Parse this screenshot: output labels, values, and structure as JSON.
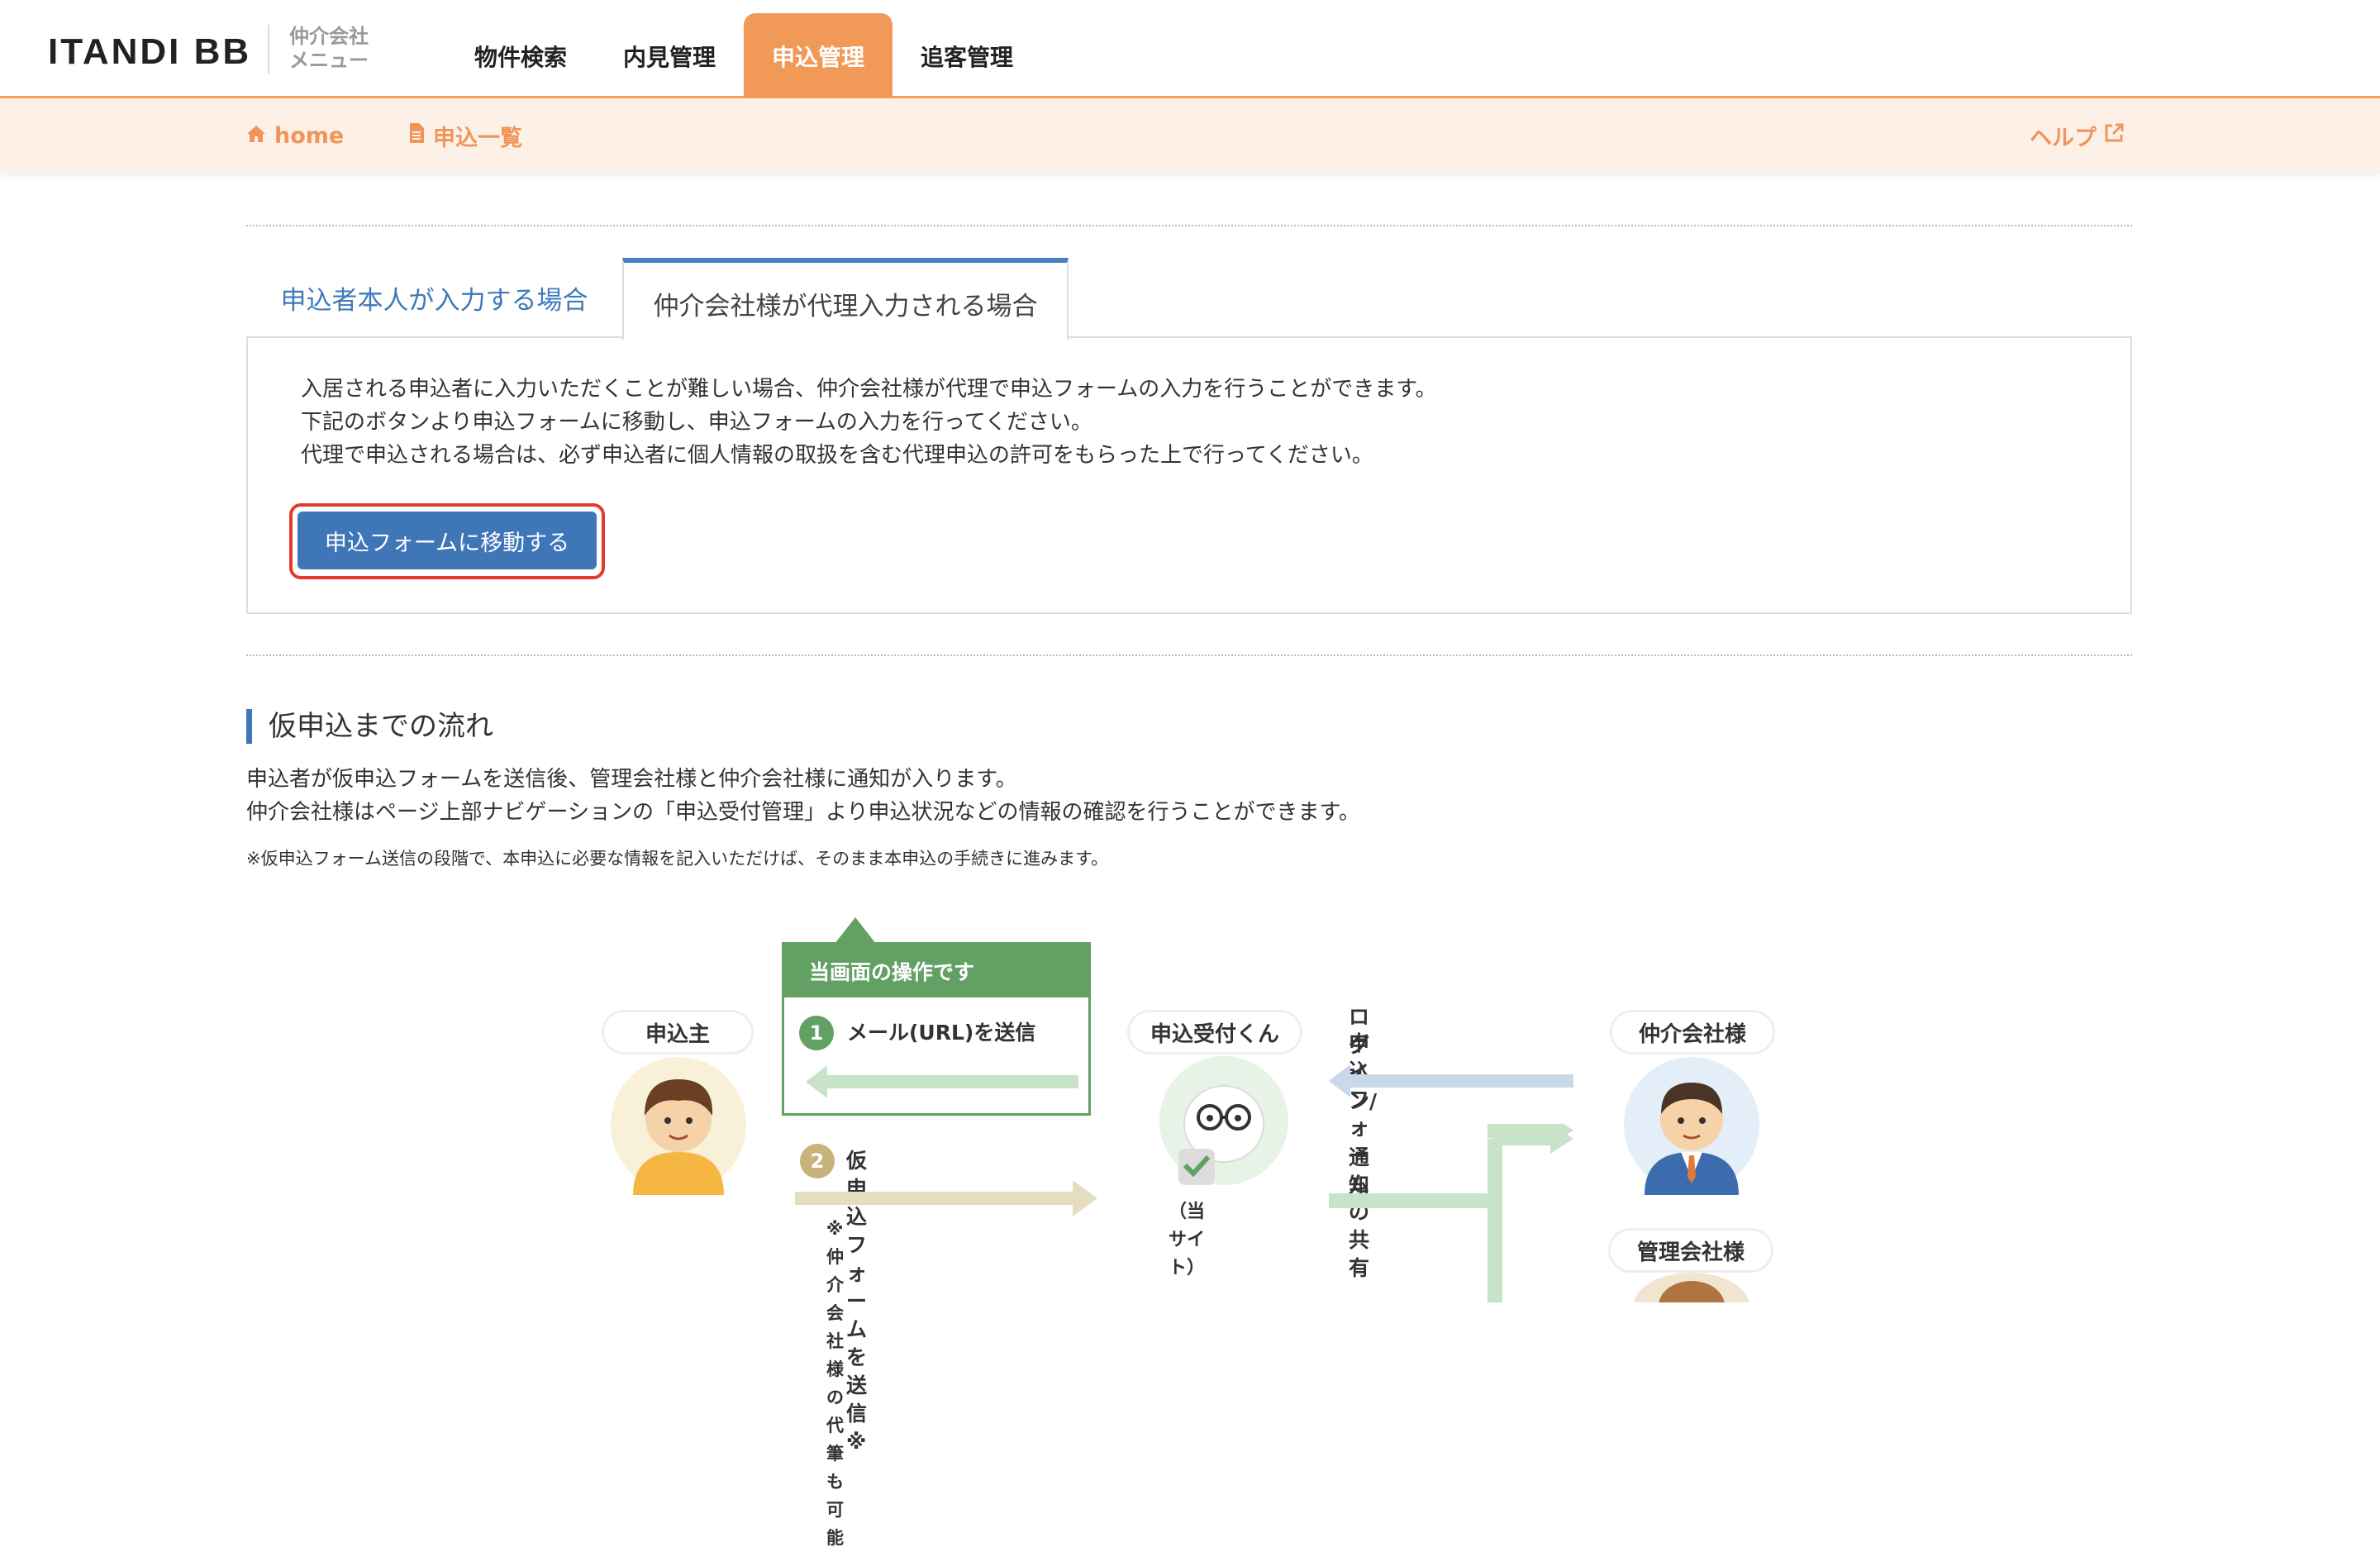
{
  "header": {
    "logo": "ITANDI BB",
    "logo_sub_line1": "仲介会社",
    "logo_sub_line2": "メニュー",
    "nav": [
      {
        "label": "物件検索",
        "active": false
      },
      {
        "label": "内見管理",
        "active": false
      },
      {
        "label": "申込管理",
        "active": true
      },
      {
        "label": "追客管理",
        "active": false
      }
    ]
  },
  "subheader": {
    "home": "home",
    "list": "申込一覧",
    "help": "ヘルプ"
  },
  "tabs": {
    "self": "申込者本人が入力する場合",
    "agent": "仲介会社様が代理入力される場合"
  },
  "panel": {
    "line1": "入居される申込者に入力いただくことが難しい場合、仲介会社様が代理で申込フォームの入力を行うことができます。",
    "line2": "下記のボタンより申込フォームに移動し、申込フォームの入力を行ってください。",
    "line3": "代理で申込される場合は、必ず申込者に個人情報の取扱を含む代理申込の許可をもらった上で行ってください。",
    "button": "申込フォームに移動する"
  },
  "flow": {
    "title": "仮申込までの流れ",
    "desc1": "申込者が仮申込フォームを送信後、管理会社様と仲介会社様に通知が入ります。",
    "desc2": "仲介会社様はページ上部ナビゲーションの「申込受付管理」より申込状況などの情報の確認を行うことができます。",
    "note": "※仮申込フォーム送信の段階で、本申込に必要な情報を記入いただけば、そのまま本申込の手続きに進みます。"
  },
  "diagram": {
    "op_header": "当画面の操作です",
    "step1_num": "1",
    "step1": "メール(URL)を送信",
    "step2_num": "2",
    "step2": "仮申込フォームを送信※",
    "step2_note": "※仲介会社様の代筆も可能",
    "applicant": "申込主",
    "receiver": "申込受付くん",
    "receiver_sub": "（当サイト）",
    "broker": "仲介会社様",
    "manager": "管理会社様",
    "login_line1": "ログイン/",
    "login_line2": "申込フォームの共有",
    "notify": "通知"
  },
  "colors": {
    "accent_orange": "#f19a58",
    "primary_blue": "#3f76b8",
    "highlight_red": "#e33a2e",
    "flow_green": "#62a064"
  }
}
